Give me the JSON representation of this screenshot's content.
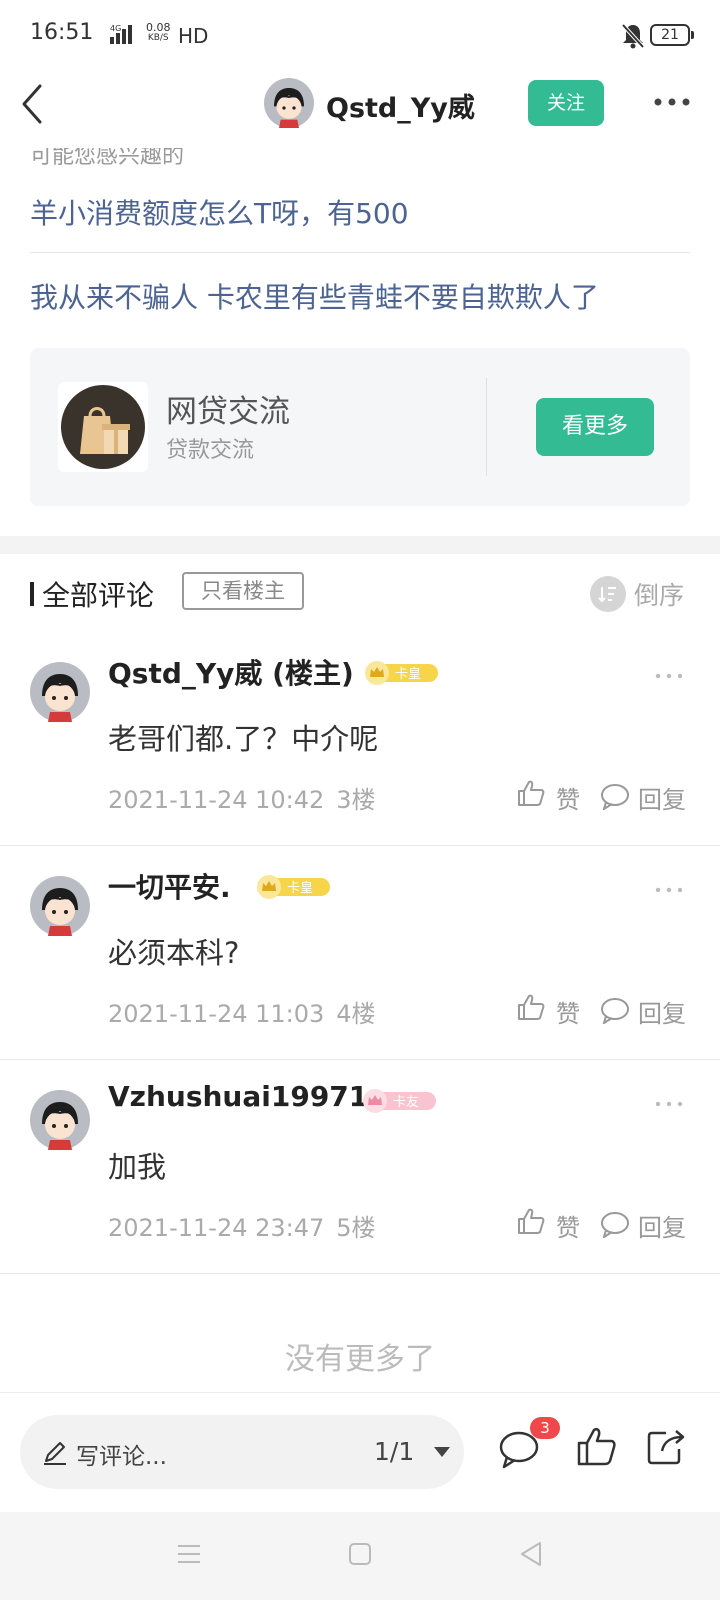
{
  "status_bar": {
    "time": "16:51",
    "network_type": "4G",
    "speed_value": "0.08",
    "speed_unit": "KB/S",
    "hd": "HD",
    "battery": "21"
  },
  "header": {
    "username": "Qstd_Yy威",
    "follow_label": "关注",
    "icons": {
      "back": "back-chevron-icon",
      "more": "more-dots-icon"
    }
  },
  "related": {
    "section_label": "可能您感兴趣的",
    "links": [
      "羊小消费额度怎么T呀，有500",
      "我从来不骗人 卡农里有些青蛙不要自欺欺人了"
    ]
  },
  "forum_card": {
    "name": "网贷交流",
    "subtitle": "贷款交流",
    "see_more_label": "看更多"
  },
  "comments_section": {
    "title": "全部评论",
    "only_op_label": "只看楼主",
    "sort_label": "倒序",
    "like_label": "赞",
    "reply_label": "回复"
  },
  "comments": [
    {
      "user": "Qstd_Yy威 (楼主)",
      "badge": "卡皇",
      "badge_color": "#f7d54a",
      "text": "老哥们都.了？中介呢",
      "time": "2021-11-24 10:42",
      "floor": "3楼"
    },
    {
      "user": "一切平安.",
      "badge": "卡皇",
      "badge_color": "#f7d54a",
      "text": "必须本科?",
      "time": "2021-11-24 11:03",
      "floor": "4楼"
    },
    {
      "user": "Vzhushuai19971",
      "badge": "卡友",
      "badge_color": "#f9c4d0",
      "text": "加我",
      "time": "2021-11-24 23:47",
      "floor": "5楼"
    }
  ],
  "no_more": "没有更多了",
  "bottom_bar": {
    "write_label": "写评论...",
    "page": "1/1",
    "comment_count": "3"
  },
  "colors": {
    "accent": "#33bc93",
    "link": "#4d6492",
    "badge_red": "#f0484a"
  }
}
